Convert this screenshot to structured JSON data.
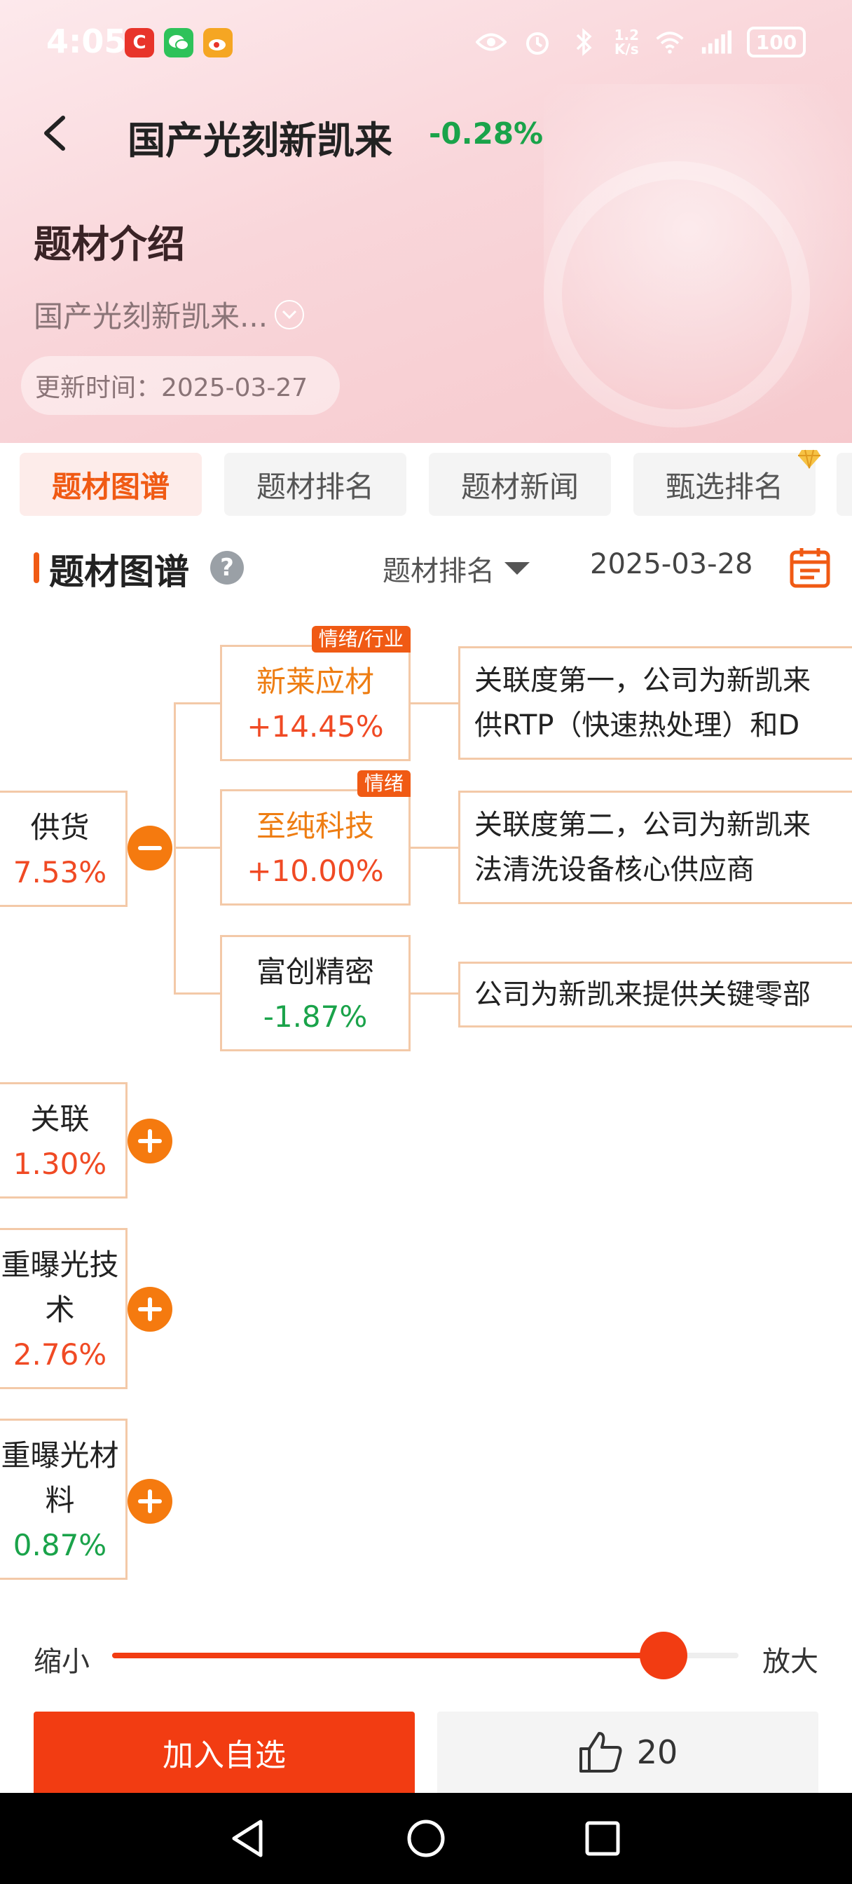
{
  "status_bar": {
    "time": "4:05",
    "net_speed_value": "1.2",
    "net_speed_unit": "K/s",
    "battery": "100",
    "apps": [
      {
        "icon": "c-app-icon",
        "label": "C",
        "color": "#e8342a"
      },
      {
        "icon": "wechat-icon",
        "label": "",
        "color": "#2ec25a"
      },
      {
        "icon": "weibo-icon",
        "label": "",
        "color": "#f5a623"
      }
    ]
  },
  "header": {
    "title": "国产光刻新凯来",
    "change_pct": "-0.28%",
    "section_title": "题材介绍",
    "description": "国产光刻新凯来...",
    "update_time_label": "更新时间：2025-03-27"
  },
  "tabs": [
    {
      "label": "题材图谱",
      "active": true
    },
    {
      "label": "题材排名",
      "active": false
    },
    {
      "label": "题材新闻",
      "active": false
    },
    {
      "label": "甄选排名",
      "active": false,
      "badge": "diamond-icon"
    }
  ],
  "map_section": {
    "title": "题材图谱",
    "sort_label": "题材排名",
    "date": "2025-03-28"
  },
  "map": {
    "expanded_group": {
      "label": "供货",
      "change": "7.53%"
    },
    "children": [
      {
        "name": "新莱应材",
        "change": "+14.45%",
        "tag": "情绪/行业",
        "desc_line1": "关联度第一，公司为新凯来",
        "desc_line2": "供RTP（快速热处理）和D"
      },
      {
        "name": "至纯科技",
        "change": "+10.00%",
        "tag": "情绪",
        "desc_line1": "关联度第二，公司为新凯来",
        "desc_line2": "法清洗设备核心供应商"
      },
      {
        "name": "富创精密",
        "change": "-1.87%",
        "tag": "",
        "desc_line1": "公司为新凯来提供关键零部"
      }
    ],
    "collapsed_groups": [
      {
        "line1": "关联",
        "line2": "",
        "change": "1.30%"
      },
      {
        "line1": "重曝光技",
        "line2": "术",
        "change": "2.76%"
      },
      {
        "line1": "重曝光材",
        "line2": "料",
        "change": "0.87%"
      }
    ]
  },
  "zoom": {
    "shrink_label": "缩小",
    "enlarge_label": "放大",
    "level": 0.88
  },
  "actions": {
    "add_watchlist": "加入自选",
    "like_count": "20"
  },
  "colors": {
    "accent": "#f23c12",
    "up": "#f04a24",
    "down": "#1aa34a",
    "node_border": "#f3c9a8"
  }
}
